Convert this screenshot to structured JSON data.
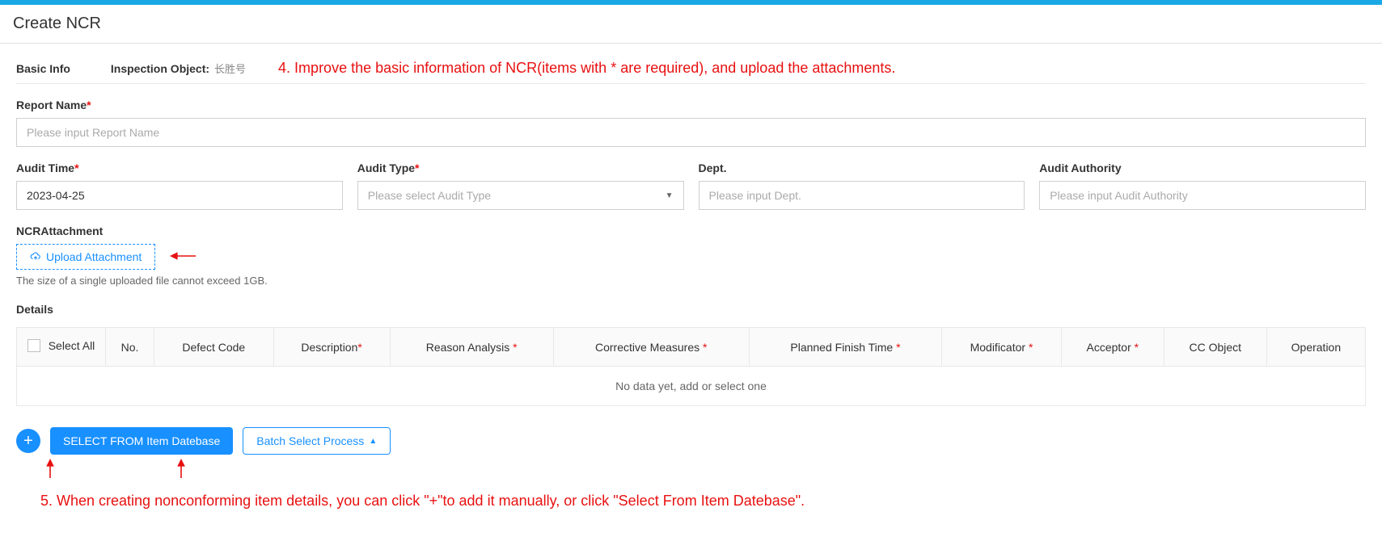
{
  "header": {
    "title": "Create NCR"
  },
  "basicInfo": {
    "sectionLabel": "Basic Info",
    "inspectionLabel": "Inspection Object:",
    "inspectionValue": "长胜号"
  },
  "annotations": {
    "step4": "4. Improve the basic information of NCR(items with * are required), and upload the attachments.",
    "step5": "5. When creating nonconforming item details, you can click \"+\"to add it manually, or click \"Select From Item Datebase\"."
  },
  "fields": {
    "reportName": {
      "label": "Report Name",
      "placeholder": "Please input Report Name"
    },
    "auditTime": {
      "label": "Audit Time",
      "value": "2023-04-25"
    },
    "auditType": {
      "label": "Audit Type",
      "placeholder": "Please select Audit Type"
    },
    "dept": {
      "label": "Dept.",
      "placeholder": "Please input Dept."
    },
    "auditAuthority": {
      "label": "Audit Authority",
      "placeholder": "Please input Audit Authority"
    }
  },
  "attachment": {
    "label": "NCRAttachment",
    "buttonLabel": "Upload Attachment",
    "hint": "The size of a single uploaded file cannot exceed 1GB."
  },
  "details": {
    "label": "Details",
    "columns": {
      "selectAll": "Select All",
      "no": "No.",
      "defectCode": "Defect Code",
      "description": "Description",
      "reasonAnalysis": "Reason Analysis ",
      "correctiveMeasures": "Corrective Measures ",
      "plannedFinishTime": "Planned Finish Time ",
      "modificator": "Modificator ",
      "acceptor": "Acceptor ",
      "ccObject": "CC Object",
      "operation": "Operation"
    },
    "emptyText": "No data yet, add or select one"
  },
  "actions": {
    "selectFromDb": "SELECT FROM Item Datebase",
    "batchSelect": "Batch Select Process"
  }
}
